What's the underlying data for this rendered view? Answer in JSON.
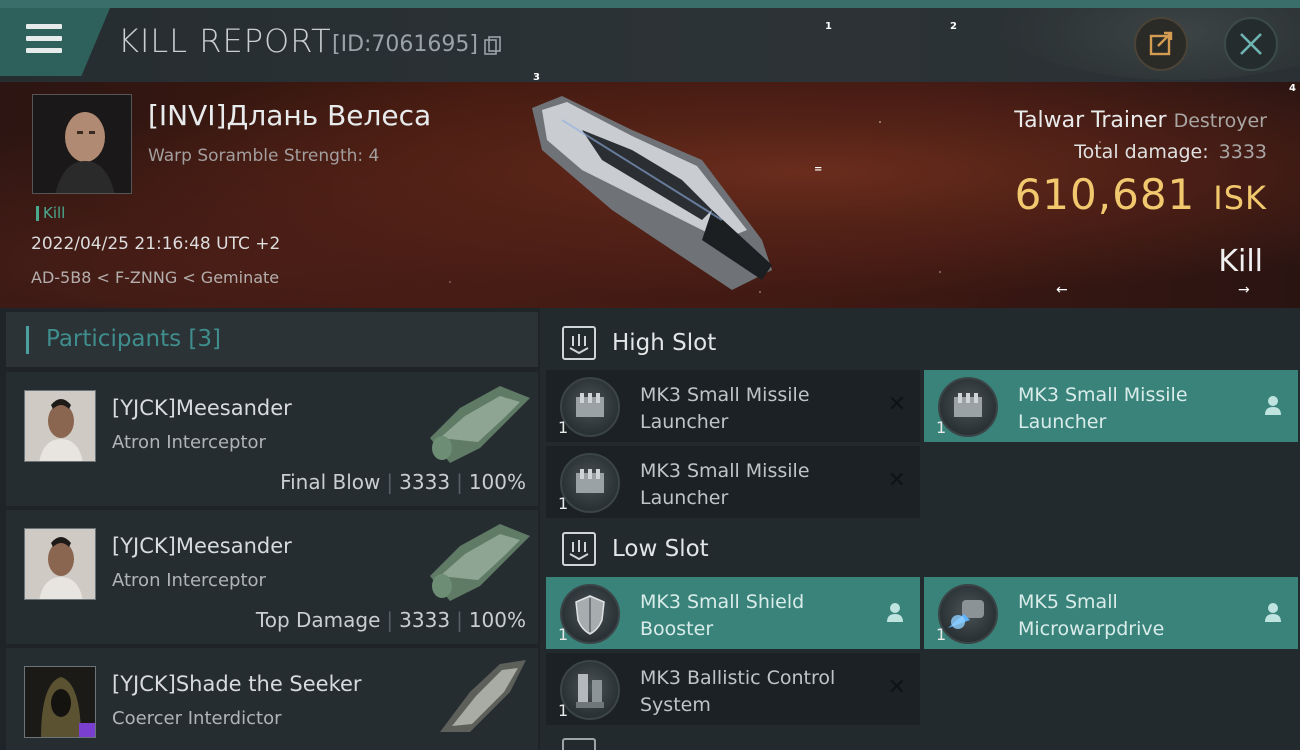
{
  "header": {
    "title": "KILL REPORT",
    "id_label": "[ID:7061695]",
    "markers": [
      "1",
      "2",
      "3",
      "4"
    ]
  },
  "victim": {
    "name": "[INVI]Длань Велеса",
    "subtitle": "Warp Soramble Strength: 4",
    "tag": "Kill",
    "datetime": "2022/04/25 21:16:48 UTC +2",
    "location": "AD-5B8 < F-ZNNG < Geminate",
    "ship_name": "Talwar Trainer",
    "ship_class": "Destroyer",
    "total_damage_label": "Total damage:",
    "total_damage_value": "3333",
    "isk_value": "610,681",
    "isk_unit": "ISK",
    "result": "Kill",
    "arrow_left": "←",
    "arrow_right": "→",
    "center_mark": "="
  },
  "participants": {
    "title": "Participants [3]",
    "items": [
      {
        "name": "[YJCK]Meesander",
        "ship": "Atron Interceptor",
        "label": "Final Blow",
        "damage": "3333",
        "percent": "100%"
      },
      {
        "name": "[YJCK]Meesander",
        "ship": "Atron Interceptor",
        "label": "Top Damage",
        "damage": "3333",
        "percent": "100%"
      },
      {
        "name": "[YJCK]Shade the Seeker",
        "ship": "Coercer Interdictor",
        "label": "",
        "damage": "",
        "percent": ""
      }
    ]
  },
  "slots": {
    "high": {
      "title": "High Slot",
      "modules": [
        {
          "name": "MK3 Small Missile Launcher",
          "qty": "1",
          "status": "destroyed"
        },
        {
          "name": "MK3 Small Missile Launcher",
          "qty": "1",
          "status": "dropped"
        },
        {
          "name": "MK3 Small Missile Launcher",
          "qty": "1",
          "status": "destroyed"
        }
      ]
    },
    "low": {
      "title": "Low Slot",
      "modules": [
        {
          "name": "MK3 Small Shield Booster",
          "qty": "1",
          "status": "dropped"
        },
        {
          "name": "MK5 Small Microwarpdrive",
          "qty": "1",
          "status": "dropped"
        },
        {
          "name": "MK3 Ballistic Control System",
          "qty": "1",
          "status": "destroyed"
        }
      ]
    }
  },
  "colors": {
    "accent": "#3a837b",
    "isk": "#f1c86e",
    "kill_tag": "#4aa98f"
  }
}
